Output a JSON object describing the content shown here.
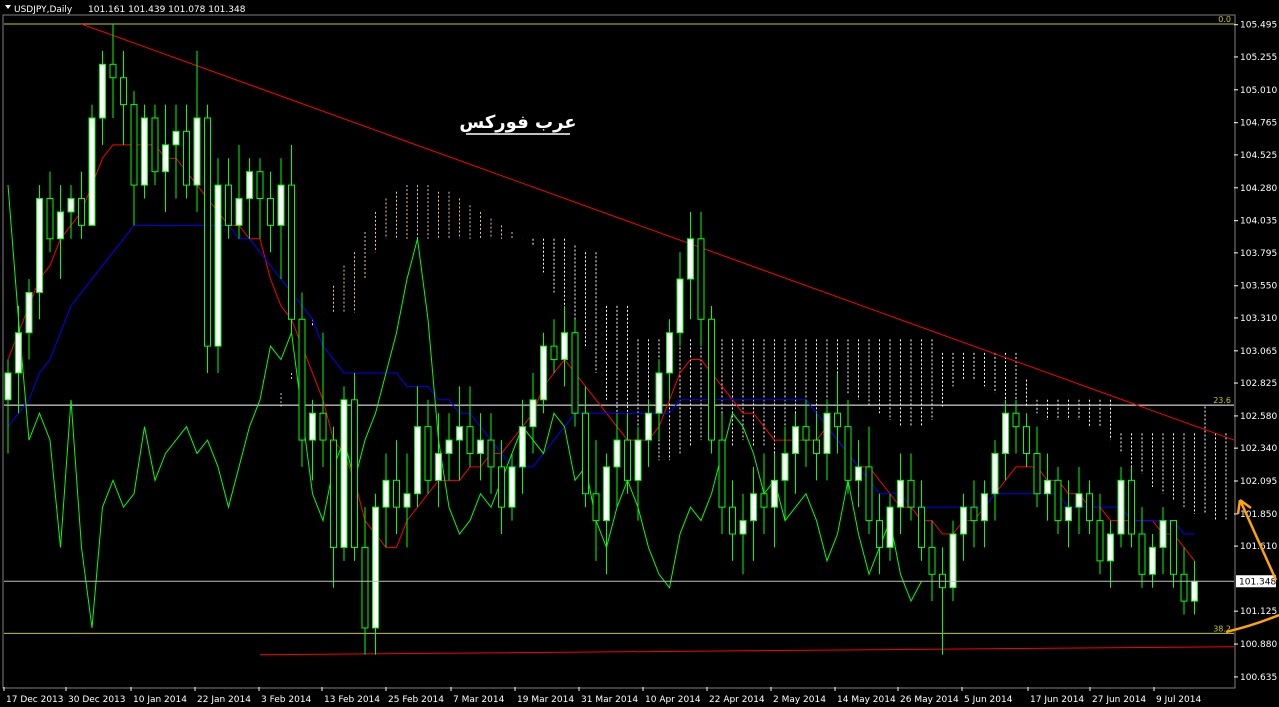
{
  "header": {
    "menu_icon": "triangle-down-icon",
    "symbol_label": "USDJPY,Daily",
    "ohlc": "101.161 101.439 101.078 101.348"
  },
  "watermark": "عرب فوركس",
  "colors": {
    "background": "#000000",
    "bull_candle": "#ffffff",
    "bear_candle": "#000000",
    "candle_outline": "#00ff00",
    "tenkan": "#ff0000",
    "kijun": "#0000ff",
    "chikou": "#00ff00",
    "cloud_up": "#f0c090",
    "cloud_down": "#ffffff",
    "fib_line": "#c8c800",
    "trendline": "#ff0000",
    "price_line": "#c0c0c0",
    "arrow": "#ffa500"
  },
  "chart_data": {
    "type": "candlestick",
    "symbol": "USDJPY",
    "timeframe": "Daily",
    "ylim": [
      100.56,
      105.56
    ],
    "y_ticks": [
      "105.495",
      "105.255",
      "105.010",
      "104.765",
      "104.525",
      "104.280",
      "104.035",
      "103.795",
      "103.550",
      "103.310",
      "103.065",
      "102.825",
      "102.580",
      "102.340",
      "102.095",
      "101.850",
      "101.610",
      "101.125",
      "100.880",
      "100.635"
    ],
    "current_price": "101.348",
    "x_ticks": [
      "17 Dec 2013",
      "30 Dec 2013",
      "10 Jan 2014",
      "22 Jan 2014",
      "3 Feb 2014",
      "13 Feb 2014",
      "25 Feb 2014",
      "7 Mar 2014",
      "19 Mar 2014",
      "31 Mar 2014",
      "10 Apr 2014",
      "22 Apr 2014",
      "2 May 2014",
      "14 May 2014",
      "26 May 2014",
      "5 Jun 2014",
      "17 Jun 2014",
      "27 Jun 2014",
      "9 Jul 2014"
    ],
    "fib_levels": [
      {
        "label": "0.0",
        "price": 105.5
      },
      {
        "label": "23.6",
        "price": 102.66
      },
      {
        "label": "38.2",
        "price": 100.96
      }
    ],
    "candles": [
      [
        102.7,
        103.0,
        102.3,
        102.9
      ],
      [
        102.9,
        103.4,
        102.6,
        103.2
      ],
      [
        103.2,
        103.6,
        103.0,
        103.5
      ],
      [
        103.5,
        104.3,
        103.3,
        104.2
      ],
      [
        104.2,
        104.4,
        103.8,
        103.9
      ],
      [
        103.9,
        104.3,
        103.6,
        104.1
      ],
      [
        104.1,
        104.3,
        103.9,
        104.2
      ],
      [
        104.2,
        104.4,
        103.9,
        104.0
      ],
      [
        104.0,
        104.9,
        104.0,
        104.8
      ],
      [
        104.8,
        105.3,
        104.6,
        105.2
      ],
      [
        105.2,
        105.5,
        104.8,
        105.1
      ],
      [
        105.1,
        105.3,
        104.6,
        104.9
      ],
      [
        104.9,
        105.0,
        104.0,
        104.3
      ],
      [
        104.3,
        104.9,
        104.2,
        104.8
      ],
      [
        104.8,
        104.9,
        104.3,
        104.4
      ],
      [
        104.4,
        104.9,
        104.1,
        104.6
      ],
      [
        104.6,
        104.9,
        104.2,
        104.7
      ],
      [
        104.7,
        104.9,
        104.2,
        104.3
      ],
      [
        104.3,
        105.3,
        104.1,
        104.8
      ],
      [
        104.8,
        104.9,
        102.9,
        103.1
      ],
      [
        103.1,
        104.5,
        102.9,
        104.3
      ],
      [
        104.3,
        104.5,
        103.9,
        104.0
      ],
      [
        104.0,
        104.6,
        103.9,
        104.2
      ],
      [
        104.2,
        104.5,
        103.9,
        104.4
      ],
      [
        104.4,
        104.5,
        103.9,
        104.2
      ],
      [
        104.2,
        104.4,
        103.8,
        104.0
      ],
      [
        104.0,
        104.5,
        103.6,
        104.3
      ],
      [
        104.3,
        104.6,
        103.2,
        103.3
      ],
      [
        103.3,
        103.5,
        102.2,
        102.4
      ],
      [
        102.4,
        102.7,
        102.1,
        102.6
      ],
      [
        102.6,
        103.2,
        102.2,
        102.4
      ],
      [
        102.4,
        102.5,
        101.3,
        101.6
      ],
      [
        101.6,
        102.8,
        101.5,
        102.7
      ],
      [
        102.7,
        102.9,
        101.5,
        101.6
      ],
      [
        101.6,
        101.9,
        100.8,
        101.0
      ],
      [
        101.0,
        102.0,
        100.8,
        101.9
      ],
      [
        101.9,
        102.3,
        101.6,
        102.1
      ],
      [
        102.1,
        102.4,
        101.7,
        101.9
      ],
      [
        101.9,
        102.3,
        101.6,
        102.0
      ],
      [
        102.0,
        102.8,
        101.9,
        102.5
      ],
      [
        102.5,
        102.7,
        102.0,
        102.1
      ],
      [
        102.1,
        102.6,
        101.9,
        102.3
      ],
      [
        102.3,
        102.6,
        102.1,
        102.4
      ],
      [
        102.4,
        102.8,
        102.1,
        102.5
      ],
      [
        102.5,
        102.8,
        102.2,
        102.3
      ],
      [
        102.3,
        102.6,
        102.1,
        102.4
      ],
      [
        102.4,
        102.6,
        102.0,
        102.2
      ],
      [
        102.2,
        102.4,
        101.7,
        101.9
      ],
      [
        101.9,
        102.3,
        101.8,
        102.2
      ],
      [
        102.2,
        102.7,
        102.0,
        102.5
      ],
      [
        102.5,
        102.9,
        102.3,
        102.7
      ],
      [
        102.7,
        103.2,
        102.6,
        103.1
      ],
      [
        103.1,
        103.3,
        102.9,
        103.0
      ],
      [
        103.0,
        103.4,
        102.8,
        103.2
      ],
      [
        103.2,
        103.3,
        102.5,
        102.6
      ],
      [
        102.6,
        102.8,
        101.9,
        102.0
      ],
      [
        102.0,
        102.4,
        101.5,
        101.8
      ],
      [
        101.8,
        102.3,
        101.4,
        102.2
      ],
      [
        102.2,
        102.6,
        101.9,
        102.4
      ],
      [
        102.4,
        102.6,
        102.0,
        102.1
      ],
      [
        102.1,
        102.5,
        101.8,
        102.4
      ],
      [
        102.4,
        102.7,
        102.2,
        102.6
      ],
      [
        102.6,
        103.0,
        102.4,
        102.9
      ],
      [
        102.9,
        103.3,
        102.7,
        103.2
      ],
      [
        103.2,
        103.8,
        103.1,
        103.6
      ],
      [
        103.6,
        104.1,
        103.3,
        103.9
      ],
      [
        103.9,
        104.1,
        103.1,
        103.3
      ],
      [
        103.3,
        103.4,
        102.3,
        102.4
      ],
      [
        102.4,
        102.6,
        101.7,
        101.9
      ],
      [
        101.9,
        102.1,
        101.5,
        101.7
      ],
      [
        101.7,
        102.0,
        101.4,
        101.8
      ],
      [
        101.8,
        102.2,
        101.5,
        102.0
      ],
      [
        102.0,
        102.3,
        101.7,
        101.9
      ],
      [
        101.9,
        102.3,
        101.6,
        102.1
      ],
      [
        102.1,
        102.5,
        101.8,
        102.3
      ],
      [
        102.3,
        102.6,
        102.0,
        102.5
      ],
      [
        102.5,
        102.7,
        102.2,
        102.4
      ],
      [
        102.4,
        102.6,
        102.1,
        102.3
      ],
      [
        102.3,
        102.7,
        102.1,
        102.6
      ],
      [
        102.6,
        102.9,
        102.3,
        102.5
      ],
      [
        102.5,
        102.7,
        102.0,
        102.1
      ],
      [
        102.1,
        102.4,
        101.9,
        102.2
      ],
      [
        102.2,
        102.5,
        101.7,
        101.8
      ],
      [
        101.8,
        102.0,
        101.4,
        101.6
      ],
      [
        101.6,
        102.0,
        101.5,
        101.9
      ],
      [
        101.9,
        102.3,
        101.7,
        102.1
      ],
      [
        102.1,
        102.3,
        101.8,
        101.9
      ],
      [
        101.9,
        102.1,
        101.5,
        101.6
      ],
      [
        101.6,
        101.8,
        101.2,
        101.4
      ],
      [
        101.4,
        101.6,
        100.8,
        101.3
      ],
      [
        101.3,
        101.8,
        101.2,
        101.7
      ],
      [
        101.7,
        102.0,
        101.5,
        101.9
      ],
      [
        101.9,
        102.1,
        101.6,
        101.8
      ],
      [
        101.8,
        102.1,
        101.6,
        102.0
      ],
      [
        102.0,
        102.4,
        101.8,
        102.3
      ],
      [
        102.3,
        102.7,
        102.1,
        102.6
      ],
      [
        102.6,
        102.7,
        102.3,
        102.5
      ],
      [
        102.5,
        102.6,
        102.2,
        102.3
      ],
      [
        102.3,
        102.5,
        101.9,
        102.0
      ],
      [
        102.0,
        102.3,
        101.8,
        102.1
      ],
      [
        102.1,
        102.2,
        101.7,
        101.8
      ],
      [
        101.8,
        102.1,
        101.6,
        101.9
      ],
      [
        101.9,
        102.2,
        101.7,
        102.0
      ],
      [
        102.0,
        102.1,
        101.7,
        101.8
      ],
      [
        101.8,
        102.0,
        101.4,
        101.5
      ],
      [
        101.5,
        101.8,
        101.3,
        101.7
      ],
      [
        101.7,
        102.2,
        101.6,
        102.1
      ],
      [
        102.1,
        102.2,
        101.6,
        101.7
      ],
      [
        101.7,
        101.9,
        101.3,
        101.4
      ],
      [
        101.4,
        101.7,
        101.3,
        101.6
      ],
      [
        101.6,
        101.9,
        101.4,
        101.8
      ],
      [
        101.8,
        101.8,
        101.3,
        101.4
      ],
      [
        101.4,
        101.6,
        101.1,
        101.2
      ],
      [
        101.2,
        101.5,
        101.1,
        101.348
      ]
    ],
    "tenkan": [
      103.0,
      103.2,
      103.4,
      103.6,
      103.7,
      103.9,
      104.0,
      104.1,
      104.3,
      104.5,
      104.6,
      104.6,
      104.6,
      104.6,
      104.6,
      104.5,
      104.5,
      104.4,
      104.3,
      104.2,
      104.1,
      104.0,
      104.0,
      103.9,
      103.9,
      103.6,
      103.4,
      103.3,
      103.1,
      102.9,
      102.7,
      102.4,
      102.3,
      102.1,
      101.8,
      101.7,
      101.6,
      101.6,
      101.8,
      101.9,
      102.0,
      102.1,
      102.1,
      102.1,
      102.2,
      102.2,
      102.3,
      102.3,
      102.4,
      102.5,
      102.6,
      102.8,
      102.9,
      103.0,
      102.9,
      102.8,
      102.7,
      102.6,
      102.5,
      102.4,
      102.4,
      102.4,
      102.5,
      102.7,
      102.9,
      103.0,
      103.0,
      102.9,
      102.8,
      102.7,
      102.6,
      102.6,
      102.5,
      102.4,
      102.4,
      102.4,
      102.4,
      102.4,
      102.5,
      102.4,
      102.3,
      102.2,
      102.2,
      102.1,
      102.0,
      101.9,
      101.9,
      101.8,
      101.8,
      101.7,
      101.7,
      101.8,
      101.8,
      101.9,
      102.0,
      102.1,
      102.2,
      102.2,
      102.2,
      102.1,
      102.1,
      102.0,
      102.0,
      101.9,
      101.9,
      101.8,
      101.8,
      101.8,
      101.8,
      101.8,
      101.7,
      101.7,
      101.6,
      101.5
    ],
    "kijun": [
      102.5,
      102.6,
      102.7,
      102.9,
      103.0,
      103.2,
      103.4,
      103.5,
      103.6,
      103.7,
      103.8,
      103.9,
      104.0,
      104.0,
      104.0,
      104.0,
      104.0,
      104.0,
      104.0,
      104.0,
      104.0,
      104.0,
      103.9,
      103.9,
      103.8,
      103.7,
      103.6,
      103.5,
      103.4,
      103.3,
      103.1,
      103.0,
      102.9,
      102.9,
      102.9,
      102.9,
      102.9,
      102.9,
      102.8,
      102.8,
      102.8,
      102.7,
      102.7,
      102.6,
      102.6,
      102.5,
      102.4,
      102.3,
      102.2,
      102.2,
      102.2,
      102.3,
      102.4,
      102.5,
      102.6,
      102.6,
      102.6,
      102.6,
      102.6,
      102.6,
      102.6,
      102.6,
      102.6,
      102.6,
      102.7,
      102.7,
      102.7,
      102.7,
      102.7,
      102.7,
      102.7,
      102.7,
      102.7,
      102.7,
      102.7,
      102.7,
      102.7,
      102.6,
      102.5,
      102.4,
      102.3,
      102.2,
      102.1,
      102.0,
      102.0,
      102.0,
      101.9,
      101.9,
      101.9,
      101.9,
      101.9,
      101.9,
      101.9,
      101.9,
      102.0,
      102.0,
      102.0,
      102.0,
      102.0,
      102.0,
      102.0,
      101.9,
      101.9,
      101.9,
      101.9,
      101.9,
      101.9,
      101.8,
      101.8,
      101.8,
      101.8,
      101.8,
      101.7,
      101.7
    ]
  }
}
